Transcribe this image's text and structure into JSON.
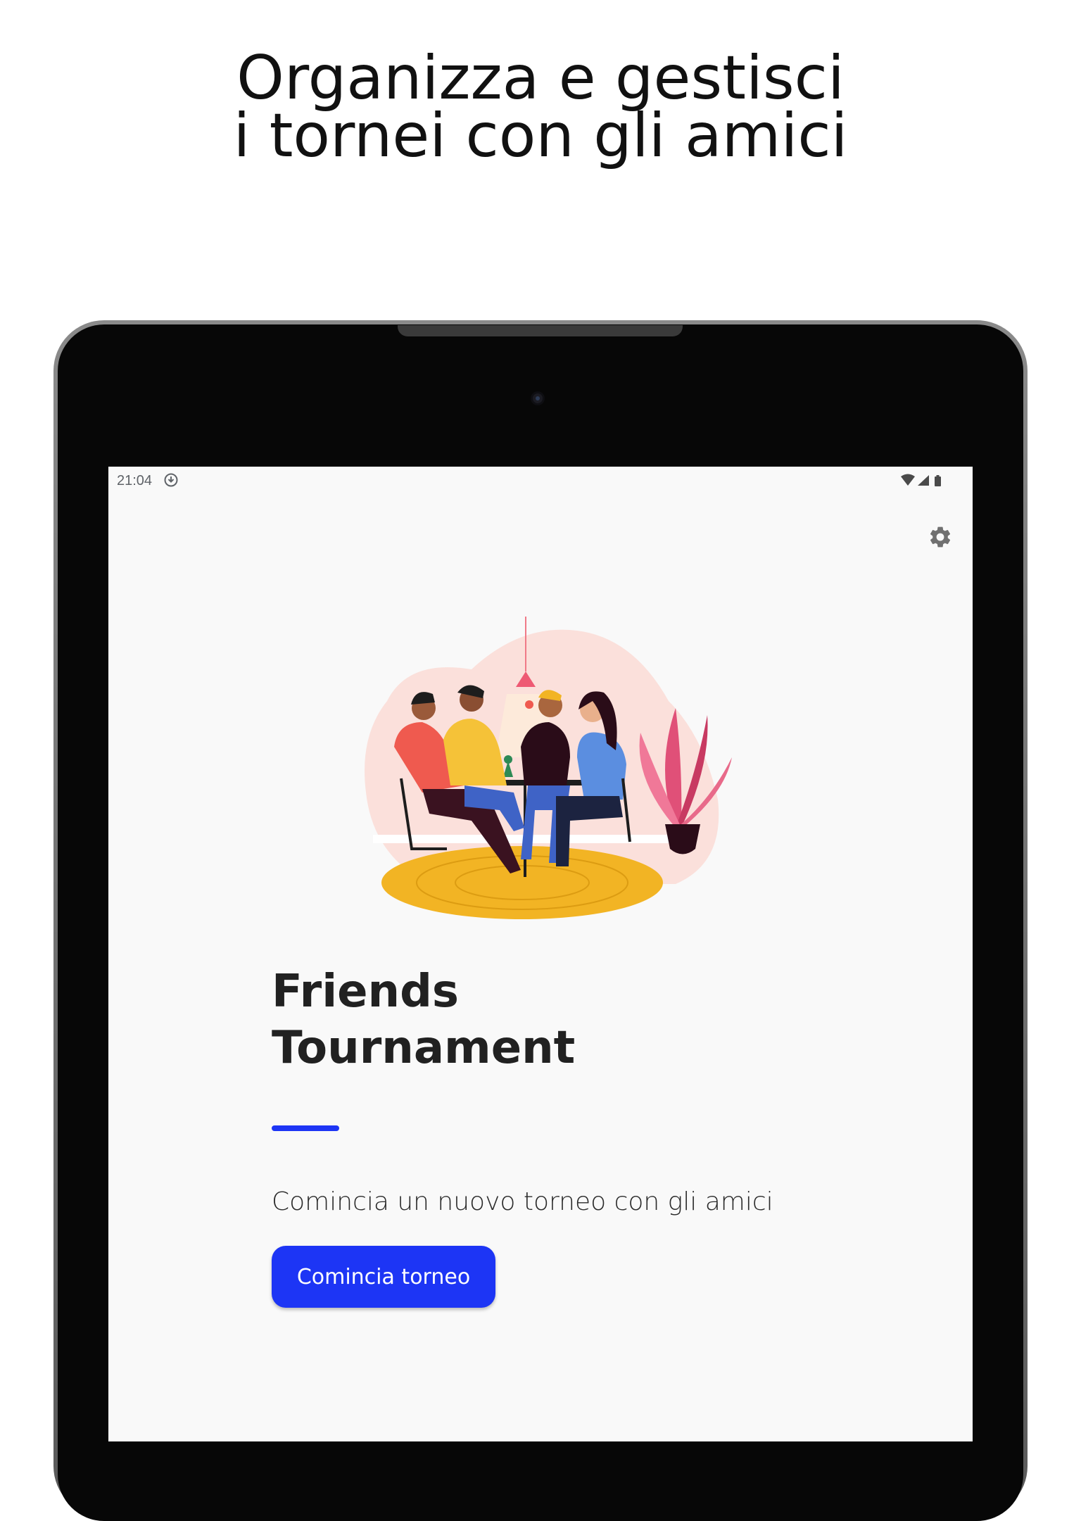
{
  "promo": {
    "headline_line1": "Organizza e gestisci",
    "headline_line2": "i tornei con gli amici"
  },
  "status_bar": {
    "time": "21:04",
    "download_icon": "download-circle-icon",
    "right_icons": [
      "wifi-icon",
      "cell-signal-icon",
      "battery-icon"
    ]
  },
  "toolbar": {
    "settings_icon": "gear-icon"
  },
  "home": {
    "illustration": "friends-playing-board-game-illustration",
    "title_line1": "Friends",
    "title_line2": "Tournament",
    "subtitle": "Comincia un nuovo torneo con gli amici",
    "start_button_label": "Comincia torneo"
  },
  "colors": {
    "accent": "#1d35f5",
    "screen_background": "#f9f9f9",
    "text_dark": "#212121",
    "device_frame": "#070707"
  }
}
